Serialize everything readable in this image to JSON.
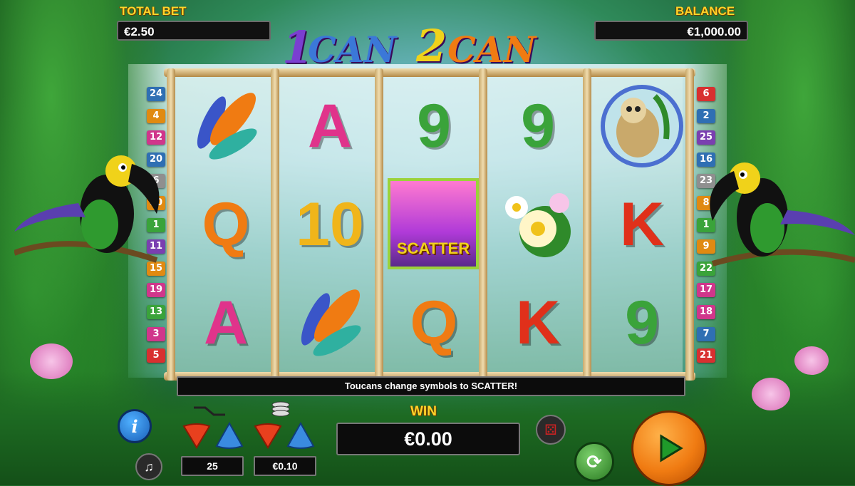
{
  "header": {
    "total_bet_label": "TOTAL BET",
    "total_bet_value": "€2.50",
    "balance_label": "BALANCE",
    "balance_value": "€1,000.00"
  },
  "logo": {
    "part1": "1",
    "part2": "CAN",
    "part3": "2",
    "part4": "CAN"
  },
  "reels": [
    [
      {
        "symbol": "feathers",
        "text": ""
      },
      {
        "symbol": "kiwi-q",
        "text": "Q"
      },
      {
        "symbol": "pineapple-a",
        "text": "A"
      }
    ],
    [
      {
        "symbol": "pineapple-a",
        "text": "A"
      },
      {
        "symbol": "pomegranate-10",
        "text": "10"
      },
      {
        "symbol": "feathers",
        "text": ""
      }
    ],
    [
      {
        "symbol": "passionfruit-9",
        "text": "9"
      },
      {
        "symbol": "scatter",
        "text": "SCATTER"
      },
      {
        "symbol": "kiwi-q",
        "text": "Q"
      }
    ],
    [
      {
        "symbol": "passionfruit-9",
        "text": "9"
      },
      {
        "symbol": "flowers",
        "text": ""
      },
      {
        "symbol": "papaya-k",
        "text": "K"
      }
    ],
    [
      {
        "symbol": "sloth",
        "text": ""
      },
      {
        "symbol": "papaya-k",
        "text": "K"
      },
      {
        "symbol": "passionfruit-9",
        "text": "9"
      }
    ]
  ],
  "paylines_left": [
    "24",
    "4",
    "12",
    "20",
    "6",
    "10",
    "1",
    "11",
    "15",
    "19",
    "13",
    "3",
    "5"
  ],
  "paylines_right": [
    "6",
    "2",
    "25",
    "16",
    "23",
    "8",
    "1",
    "9",
    "22",
    "17",
    "18",
    "7",
    "21"
  ],
  "colors_left": [
    "#2f6fb3",
    "#e08a12",
    "#d0368b",
    "#2f6fb3",
    "#8f8f8f",
    "#e08a12",
    "#3aa33a",
    "#7a3fb0",
    "#e08a12",
    "#d0368b",
    "#3aa33a",
    "#d0368b",
    "#d83030"
  ],
  "colors_right": [
    "#d83030",
    "#2f6fb3",
    "#7a3fb0",
    "#2f6fb3",
    "#8f8f8f",
    "#e08a12",
    "#3aa33a",
    "#e08a12",
    "#3aa33a",
    "#d0368b",
    "#d0368b",
    "#2f6fb3",
    "#d83030"
  ],
  "message": "Toucans change symbols to SCATTER!",
  "win": {
    "label": "WIN",
    "value": "€0.00"
  },
  "controls": {
    "lines_value": "25",
    "coin_value": "€0.10"
  },
  "accent": {
    "gold": "#ffd52a",
    "spin": "#f07b12"
  }
}
